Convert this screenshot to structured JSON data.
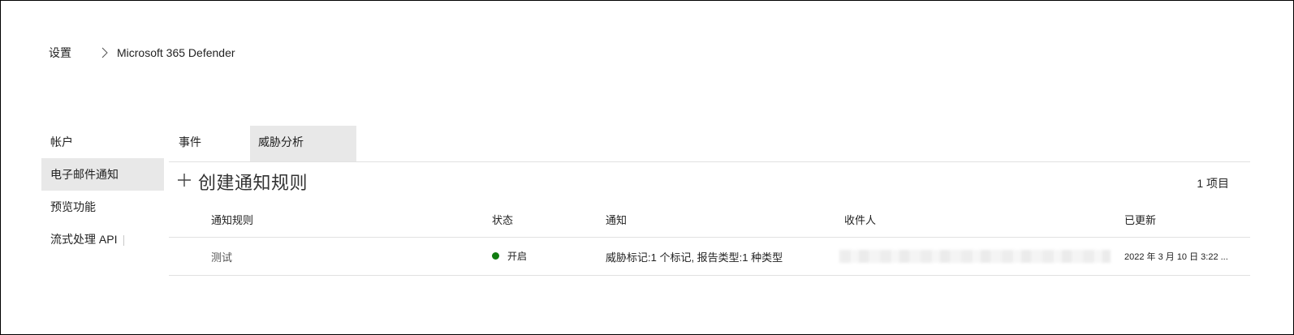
{
  "breadcrumb": {
    "items": [
      "设置",
      "Microsoft 365 Defender"
    ]
  },
  "nav": {
    "items": [
      {
        "label": "帐户"
      },
      {
        "label": "电子邮件通知"
      },
      {
        "label": "预览功能"
      },
      {
        "label": "流式处理 API"
      }
    ],
    "active_index": 1
  },
  "tabs": [
    {
      "label": "事件"
    },
    {
      "label": "威胁分析"
    }
  ],
  "toolbar": {
    "create_label": "创建通知规则",
    "item_count": "1 项目"
  },
  "table": {
    "columns": [
      "通知规则",
      "状态",
      "通知",
      "收件人",
      "已更新"
    ],
    "rows": [
      {
        "name": "测试",
        "status": "开启",
        "notification": "威胁标记:1 个标记, 报告类型:1 种类型",
        "recipients": "",
        "updated": "2022 年 3 月 10 日 3:22 ..."
      }
    ]
  },
  "colors": {
    "active_background": "#e8e8e8",
    "status_on": "#107c10",
    "divider": "#e1e1e1"
  }
}
